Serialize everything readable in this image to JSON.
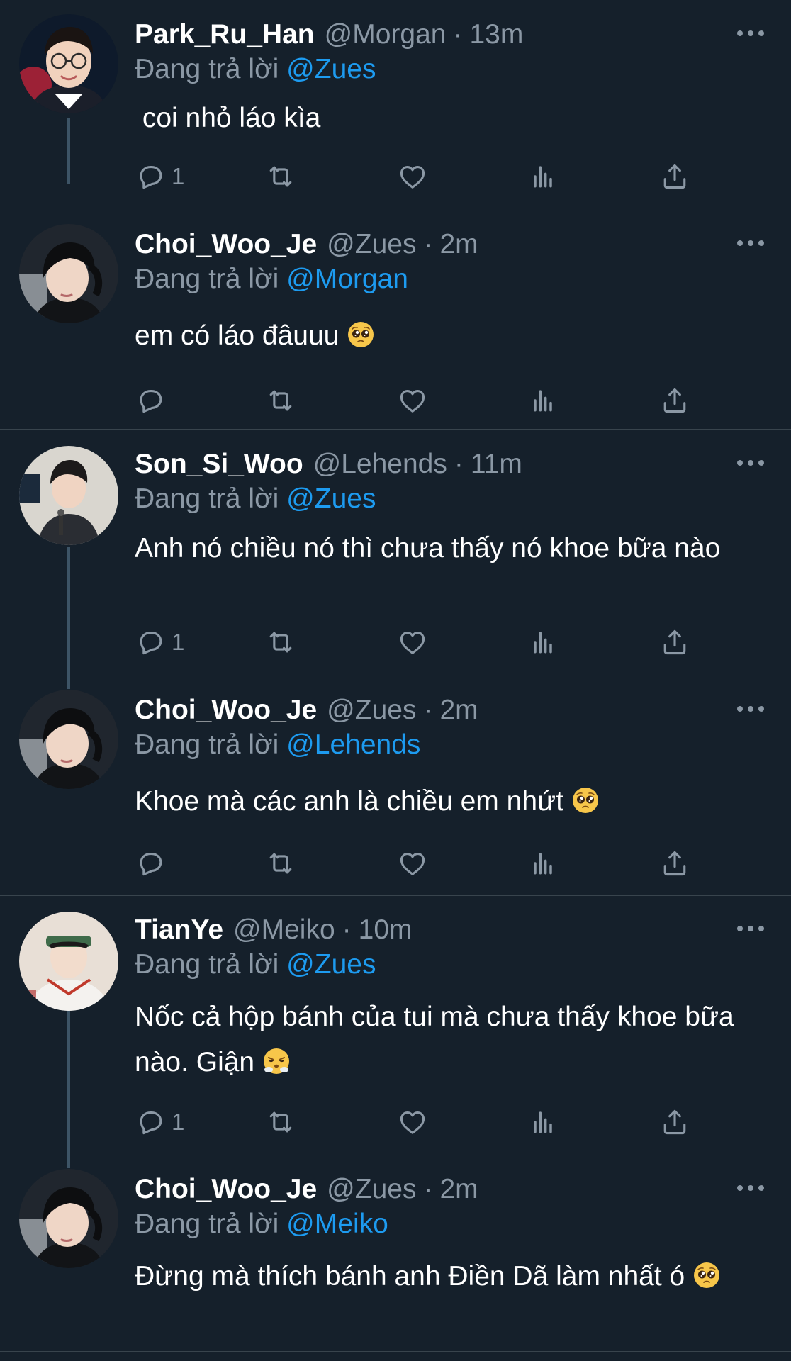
{
  "theme": {
    "background": "#15202b",
    "text_primary": "#ffffff",
    "text_secondary": "#8b98a5",
    "accent": "#1d9bf0",
    "divider": "#38444d",
    "thread_line": "#3d5466"
  },
  "threads": [
    {
      "parent": {
        "name": "Park_Ru_Han",
        "handle": "@Morgan",
        "separator": "·",
        "time": "13m",
        "replying_prefix": "Đang trả lời",
        "replying_to": "@Zues",
        "text": " coi nhỏ láo kìa",
        "reply_count": "1",
        "avatar_icon": "avatar-park-ru-han"
      },
      "reply": {
        "name": "Choi_Woo_Je",
        "handle": "@Zues",
        "separator": "·",
        "time": "2m",
        "replying_prefix": "Đang trả lời",
        "replying_to": "@Morgan",
        "text": "em có láo đâuuu",
        "emoji": "pleading-face-emoji",
        "reply_count": "",
        "avatar_icon": "avatar-choi-woo-je"
      }
    },
    {
      "parent": {
        "name": "Son_Si_Woo",
        "handle": "@Lehends",
        "separator": "·",
        "time": "11m",
        "replying_prefix": "Đang trả lời",
        "replying_to": "@Zues",
        "text": "Anh nó chiều nó thì chưa thấy nó khoe bữa nào",
        "reply_count": "1",
        "avatar_icon": "avatar-son-si-woo"
      },
      "reply": {
        "name": "Choi_Woo_Je",
        "handle": "@Zues",
        "separator": "·",
        "time": "2m",
        "replying_prefix": "Đang trả lời",
        "replying_to": "@Lehends",
        "text": "Khoe mà các anh là chiều em nhứt",
        "emoji": "pleading-face-emoji",
        "reply_count": "",
        "avatar_icon": "avatar-choi-woo-je"
      }
    },
    {
      "parent": {
        "name": "TianYe",
        "handle": "@Meiko",
        "separator": "·",
        "time": "10m",
        "replying_prefix": "Đang trả lời",
        "replying_to": "@Zues",
        "text": "Nốc cả hộp bánh của tui mà chưa thấy khoe bữa nào. Giận",
        "emoji": "face-with-steam-emoji",
        "reply_count": "1",
        "avatar_icon": "avatar-tianye"
      },
      "reply": {
        "name": "Choi_Woo_Je",
        "handle": "@Zues",
        "separator": "·",
        "time": "2m",
        "replying_prefix": "Đang trả lời",
        "replying_to": "@Meiko",
        "text": "Đừng mà thích bánh anh Điền Dã làm nhất ó",
        "emoji": "pleading-face-emoji",
        "avatar_icon": "avatar-choi-woo-je"
      }
    }
  ],
  "action_icons": [
    "reply-icon",
    "retweet-icon",
    "like-icon",
    "views-icon",
    "share-icon"
  ]
}
